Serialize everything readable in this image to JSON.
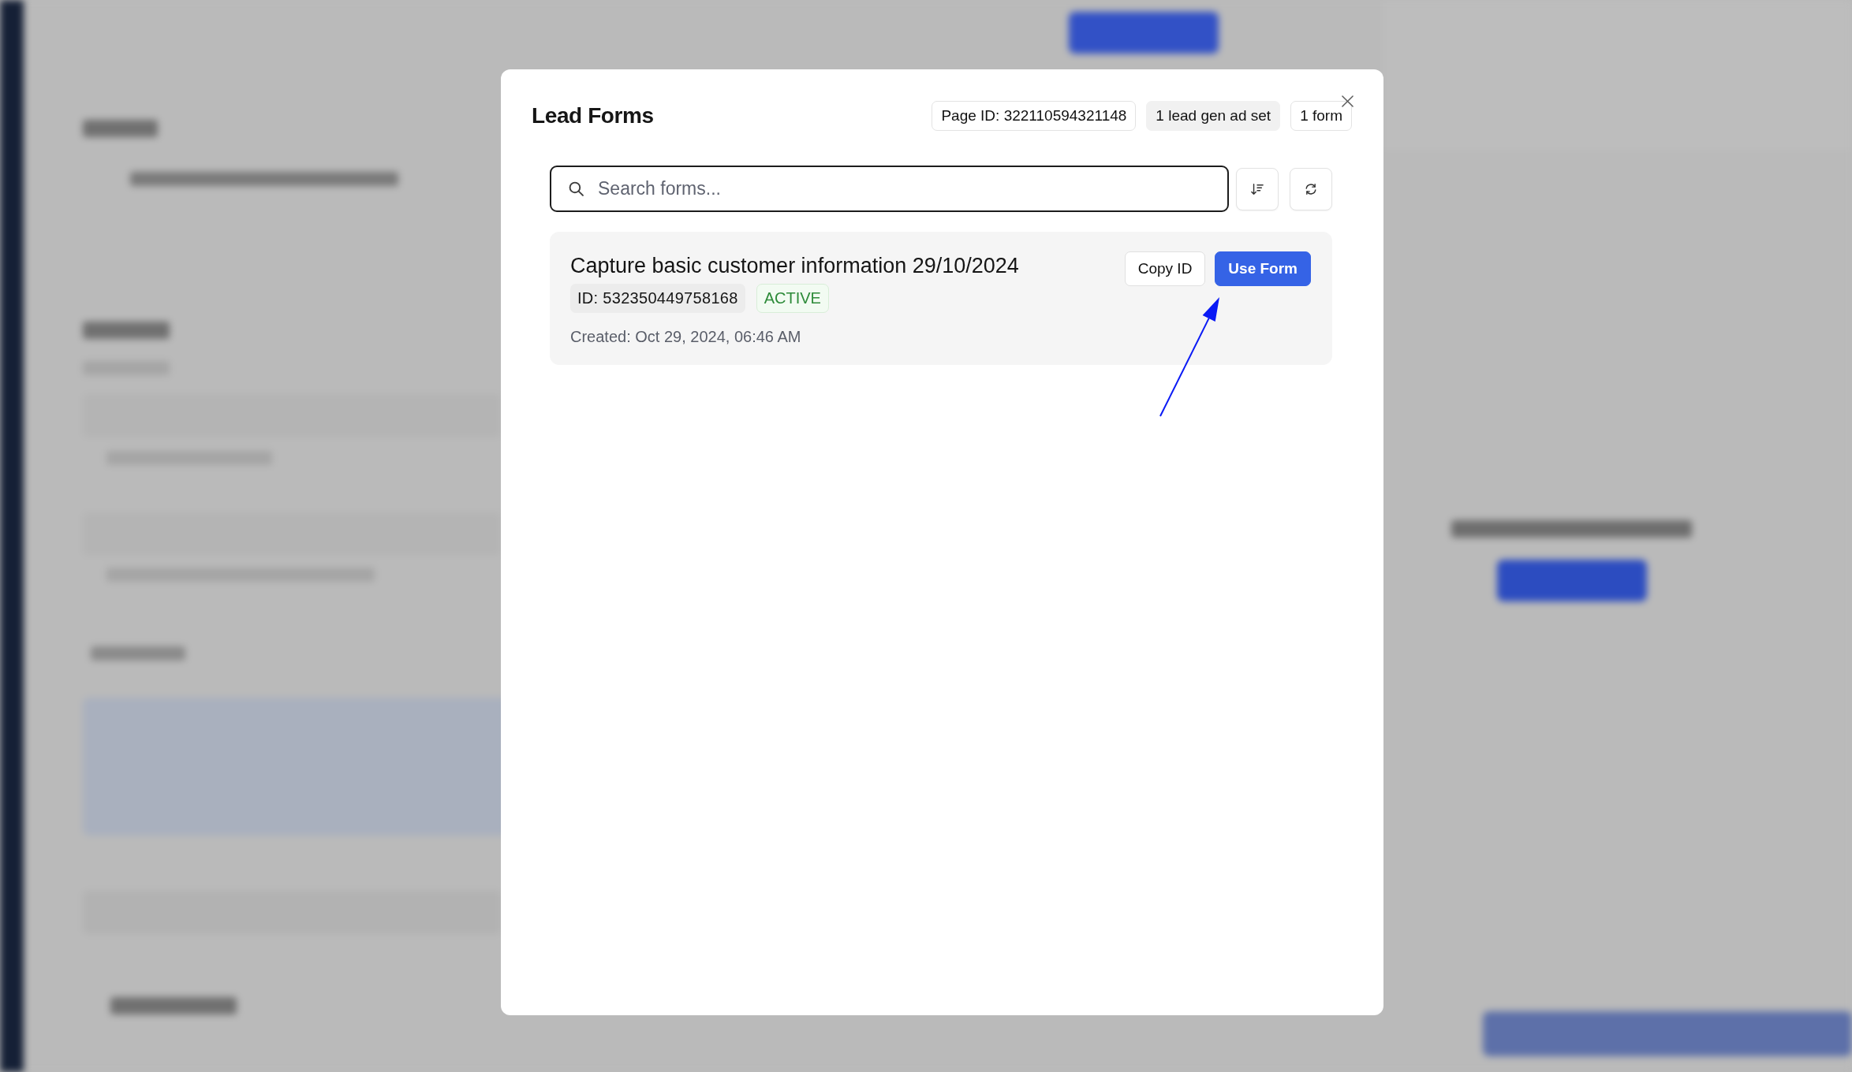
{
  "modal": {
    "title": "Lead Forms",
    "badges": [
      {
        "label": "Page ID: 322110594321148",
        "kind": "outline"
      },
      {
        "label": "1 lead gen ad set",
        "kind": "filled"
      },
      {
        "label": "1 form",
        "kind": "outline"
      }
    ]
  },
  "search": {
    "placeholder": "Search forms..."
  },
  "forms": [
    {
      "title": "Capture basic customer information 29/10/2024",
      "id": "ID: 532350449758168",
      "status": {
        "label": "ACTIVE",
        "kind": "success"
      },
      "created": "Created: Oct 29, 2024, 06:46 AM",
      "buttons": [
        {
          "label": "Copy ID",
          "kind": "secondary"
        },
        {
          "label": "Use Form",
          "kind": "primary"
        }
      ]
    }
  ]
}
